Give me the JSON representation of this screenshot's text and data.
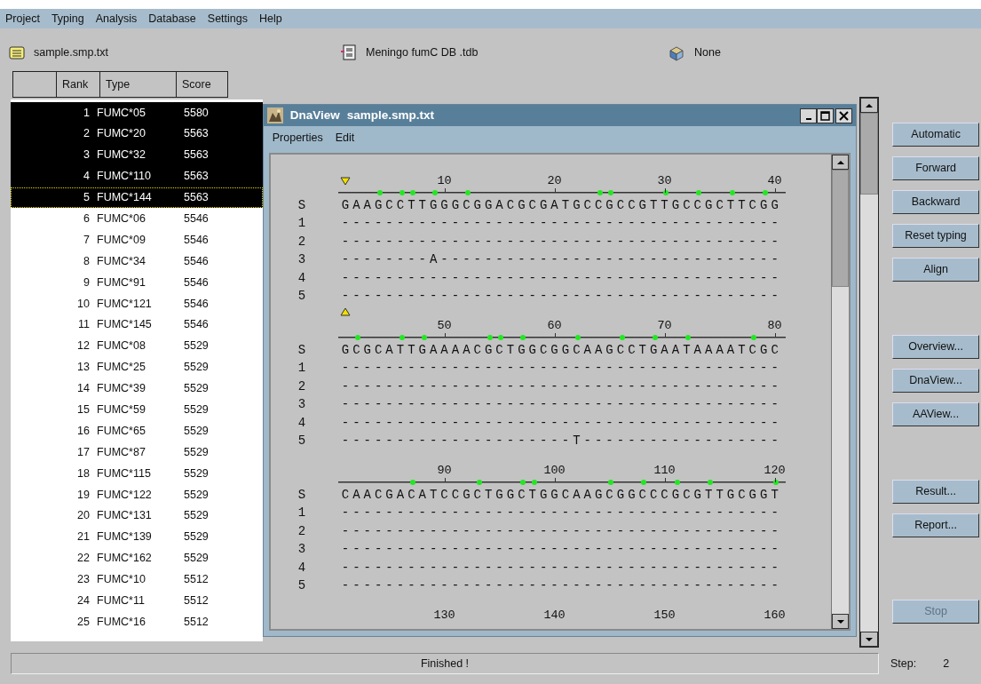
{
  "menu": [
    "Project",
    "Typing",
    "Analysis",
    "Database",
    "Settings",
    "Help"
  ],
  "toolbar": {
    "sample_file": "sample.smp.txt",
    "database": "Meningo fumC DB .tdb",
    "profile": "None"
  },
  "table": {
    "columns": [
      "Rank",
      "Type",
      "Score"
    ],
    "rows": [
      {
        "rank": "1",
        "type": "FUMC*05",
        "score": "5580",
        "selected": true,
        "focused": false
      },
      {
        "rank": "2",
        "type": "FUMC*20",
        "score": "5563",
        "selected": true,
        "focused": false
      },
      {
        "rank": "3",
        "type": "FUMC*32",
        "score": "5563",
        "selected": true,
        "focused": false
      },
      {
        "rank": "4",
        "type": "FUMC*110",
        "score": "5563",
        "selected": true,
        "focused": false
      },
      {
        "rank": "5",
        "type": "FUMC*144",
        "score": "5563",
        "selected": true,
        "focused": true
      },
      {
        "rank": "6",
        "type": "FUMC*06",
        "score": "5546",
        "selected": false,
        "focused": false
      },
      {
        "rank": "7",
        "type": "FUMC*09",
        "score": "5546",
        "selected": false,
        "focused": false
      },
      {
        "rank": "8",
        "type": "FUMC*34",
        "score": "5546",
        "selected": false,
        "focused": false
      },
      {
        "rank": "9",
        "type": "FUMC*91",
        "score": "5546",
        "selected": false,
        "focused": false
      },
      {
        "rank": "10",
        "type": "FUMC*121",
        "score": "5546",
        "selected": false,
        "focused": false
      },
      {
        "rank": "11",
        "type": "FUMC*145",
        "score": "5546",
        "selected": false,
        "focused": false
      },
      {
        "rank": "12",
        "type": "FUMC*08",
        "score": "5529",
        "selected": false,
        "focused": false
      },
      {
        "rank": "13",
        "type": "FUMC*25",
        "score": "5529",
        "selected": false,
        "focused": false
      },
      {
        "rank": "14",
        "type": "FUMC*39",
        "score": "5529",
        "selected": false,
        "focused": false
      },
      {
        "rank": "15",
        "type": "FUMC*59",
        "score": "5529",
        "selected": false,
        "focused": false
      },
      {
        "rank": "16",
        "type": "FUMC*65",
        "score": "5529",
        "selected": false,
        "focused": false
      },
      {
        "rank": "17",
        "type": "FUMC*87",
        "score": "5529",
        "selected": false,
        "focused": false
      },
      {
        "rank": "18",
        "type": "FUMC*115",
        "score": "5529",
        "selected": false,
        "focused": false
      },
      {
        "rank": "19",
        "type": "FUMC*122",
        "score": "5529",
        "selected": false,
        "focused": false
      },
      {
        "rank": "20",
        "type": "FUMC*131",
        "score": "5529",
        "selected": false,
        "focused": false
      },
      {
        "rank": "21",
        "type": "FUMC*139",
        "score": "5529",
        "selected": false,
        "focused": false
      },
      {
        "rank": "22",
        "type": "FUMC*162",
        "score": "5529",
        "selected": false,
        "focused": false
      },
      {
        "rank": "23",
        "type": "FUMC*10",
        "score": "5512",
        "selected": false,
        "focused": false
      },
      {
        "rank": "24",
        "type": "FUMC*11",
        "score": "5512",
        "selected": false,
        "focused": false
      },
      {
        "rank": "25",
        "type": "FUMC*16",
        "score": "5512",
        "selected": false,
        "focused": false
      }
    ]
  },
  "dna_view": {
    "title": "DnaView",
    "file": "sample.smp.txt",
    "menu": [
      "Properties",
      "Edit"
    ],
    "blocks": [
      {
        "down_marker": true,
        "up_marker": false,
        "ticks": [
          "10",
          "20",
          "30",
          "40"
        ],
        "variable_sites": [
          false,
          false,
          false,
          true,
          false,
          true,
          true,
          false,
          true,
          false,
          false,
          true,
          false,
          false,
          false,
          false,
          false,
          false,
          false,
          false,
          false,
          false,
          false,
          true,
          true,
          false,
          false,
          false,
          false,
          true,
          false,
          false,
          true,
          false,
          false,
          true,
          false,
          false,
          true,
          false
        ],
        "sequence_label": "S",
        "sequence": "GAAGCCTTGGGCGGACGCGATGCCGCCGTTGCCGCTTCGG",
        "rows": [
          {
            "label": "1",
            "text": "----------------------------------------"
          },
          {
            "label": "2",
            "text": "----------------------------------------"
          },
          {
            "label": "3",
            "text": "--------A-------------------------------"
          },
          {
            "label": "4",
            "text": "----------------------------------------"
          },
          {
            "label": "5",
            "text": "----------------------------------------"
          }
        ]
      },
      {
        "down_marker": false,
        "up_marker": true,
        "ticks": [
          "50",
          "60",
          "70",
          "80"
        ],
        "variable_sites": [
          false,
          true,
          false,
          false,
          false,
          true,
          false,
          true,
          false,
          false,
          false,
          false,
          false,
          true,
          true,
          false,
          true,
          false,
          false,
          false,
          false,
          true,
          false,
          false,
          false,
          true,
          false,
          false,
          true,
          false,
          false,
          true,
          false,
          false,
          false,
          false,
          false,
          true,
          false,
          false
        ],
        "sequence_label": "S",
        "sequence": "GCGCATTGAAAACGCTGGCGGCAAGCCTGAATAAAATCGC",
        "rows": [
          {
            "label": "1",
            "text": "----------------------------------------"
          },
          {
            "label": "2",
            "text": "----------------------------------------"
          },
          {
            "label": "3",
            "text": "----------------------------------------"
          },
          {
            "label": "4",
            "text": "----------------------------------------"
          },
          {
            "label": "5",
            "text": "---------------------T------------------"
          }
        ]
      },
      {
        "down_marker": false,
        "up_marker": false,
        "ticks": [
          "90",
          "100",
          "110",
          "120"
        ],
        "variable_sites": [
          false,
          false,
          false,
          false,
          false,
          false,
          true,
          false,
          false,
          false,
          false,
          false,
          true,
          false,
          false,
          false,
          true,
          true,
          false,
          false,
          false,
          false,
          false,
          false,
          true,
          false,
          false,
          true,
          false,
          false,
          true,
          false,
          false,
          true,
          false,
          false,
          false,
          false,
          false,
          true
        ],
        "sequence_label": "S",
        "sequence": "CAACGACATCCGCTGGCTGGCAAGCGGCCCGCGTTGCGGT",
        "rows": [
          {
            "label": "1",
            "text": "----------------------------------------"
          },
          {
            "label": "2",
            "text": "----------------------------------------"
          },
          {
            "label": "3",
            "text": "----------------------------------------"
          },
          {
            "label": "4",
            "text": "----------------------------------------"
          },
          {
            "label": "5",
            "text": "----------------------------------------"
          }
        ]
      },
      {
        "ticks": [
          "130",
          "140",
          "150",
          "160"
        ]
      }
    ]
  },
  "buttons": [
    [
      {
        "label": "Automatic",
        "disabled": false
      },
      {
        "label": "Forward",
        "disabled": false
      },
      {
        "label": "Backward",
        "disabled": false
      },
      {
        "label": "Reset typing",
        "disabled": false
      },
      {
        "label": "Align",
        "disabled": false
      }
    ],
    [
      {
        "label": "Overview...",
        "disabled": false
      },
      {
        "label": "DnaView...",
        "disabled": false
      },
      {
        "label": "AAView...",
        "disabled": false
      }
    ],
    [
      {
        "label": "Result...",
        "disabled": false
      },
      {
        "label": "Report...",
        "disabled": false
      }
    ],
    [
      {
        "label": "Stop",
        "disabled": true
      }
    ]
  ],
  "status": {
    "message": "Finished !",
    "step_label": "Step:",
    "step": "2"
  }
}
